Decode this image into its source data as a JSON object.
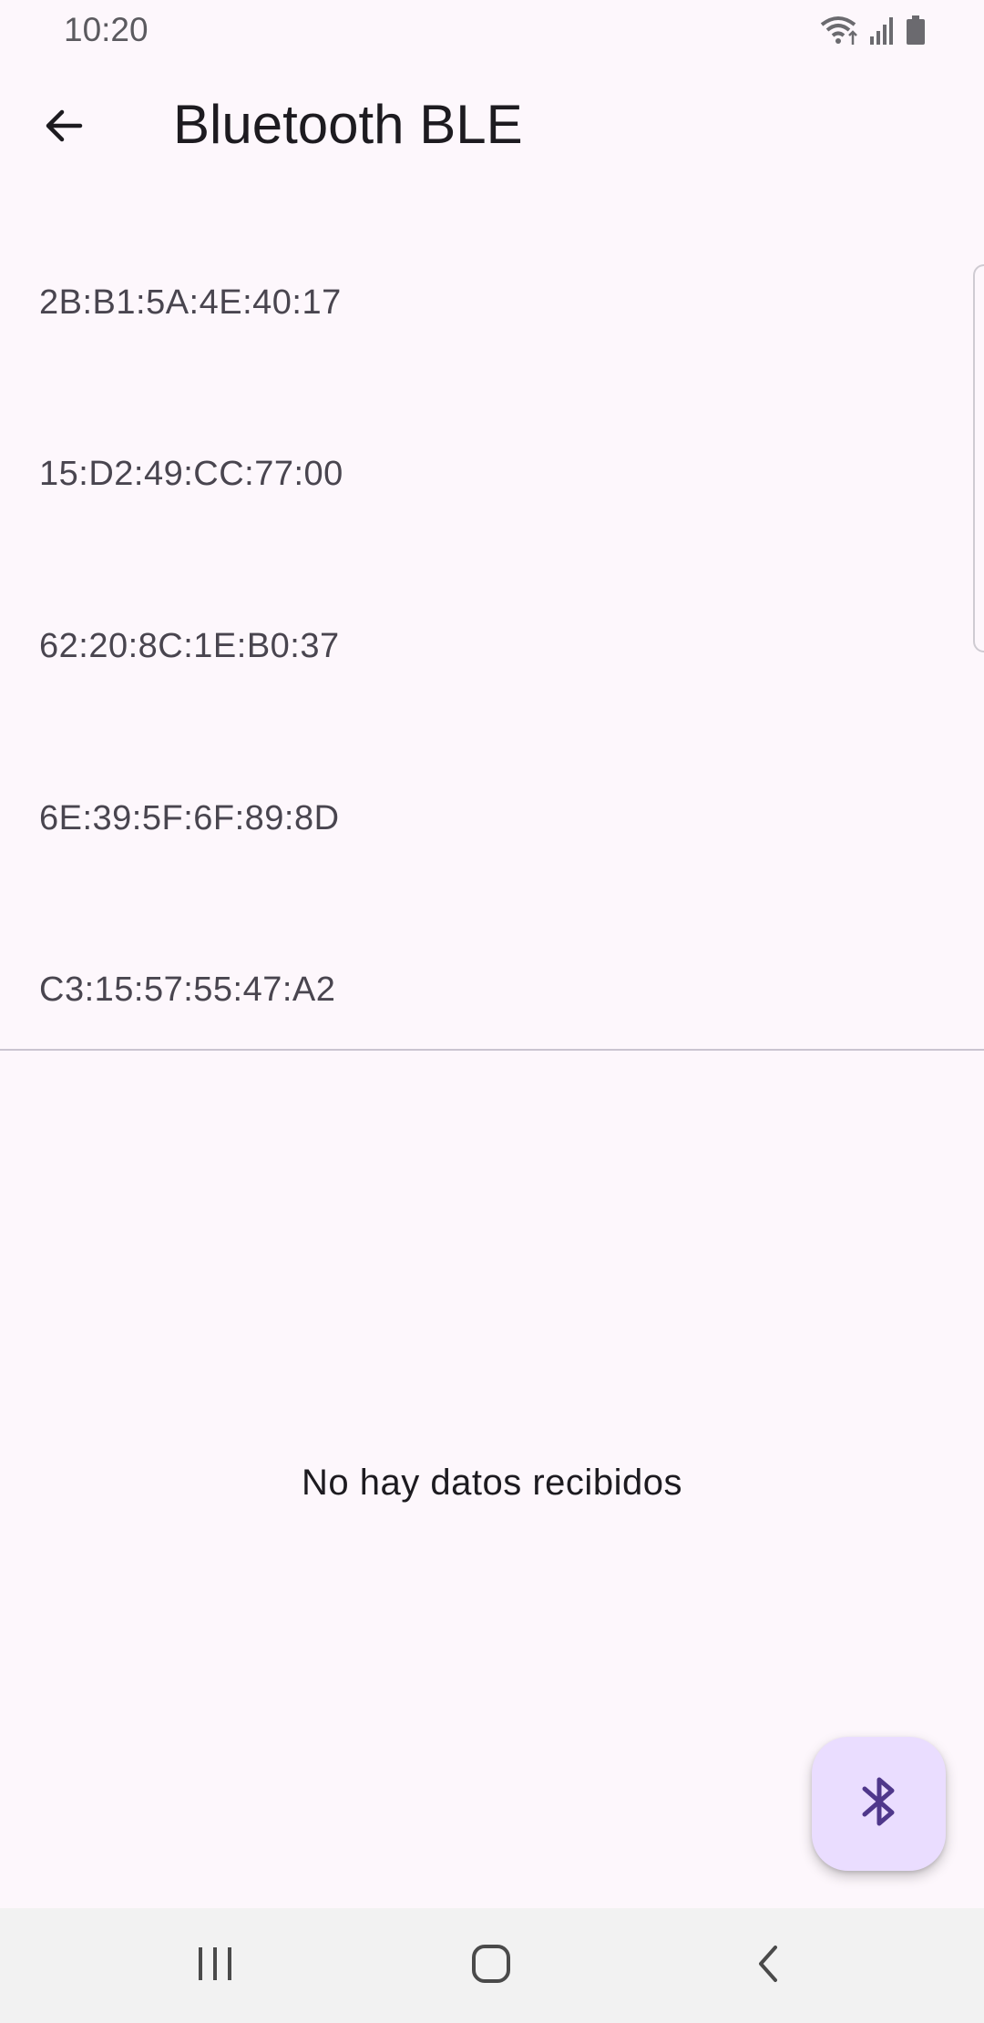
{
  "status_bar": {
    "time": "10:20",
    "icons": [
      "wifi-icon",
      "signal-icon",
      "battery-icon"
    ]
  },
  "app_bar": {
    "back_icon": "arrow-back-icon",
    "title": "Bluetooth BLE"
  },
  "devices": [
    {
      "address": "2B:B1:5A:4E:40:17"
    },
    {
      "address": "15:D2:49:CC:77:00"
    },
    {
      "address": "62:20:8C:1E:B0:37"
    },
    {
      "address": "6E:39:5F:6F:89:8D"
    },
    {
      "address": "C3:15:57:55:47:A2"
    }
  ],
  "empty_message": "No hay datos recibidos",
  "fab": {
    "icon": "bluetooth-icon",
    "color": "#4f378b",
    "background": "#eaddff"
  },
  "nav_bar": {
    "buttons": [
      "recents-icon",
      "home-icon",
      "back-icon"
    ]
  },
  "colors": {
    "background": "#fdf7fc",
    "text_primary": "#1d1b20",
    "text_secondary": "#49454f",
    "divider": "#cac4d0"
  }
}
